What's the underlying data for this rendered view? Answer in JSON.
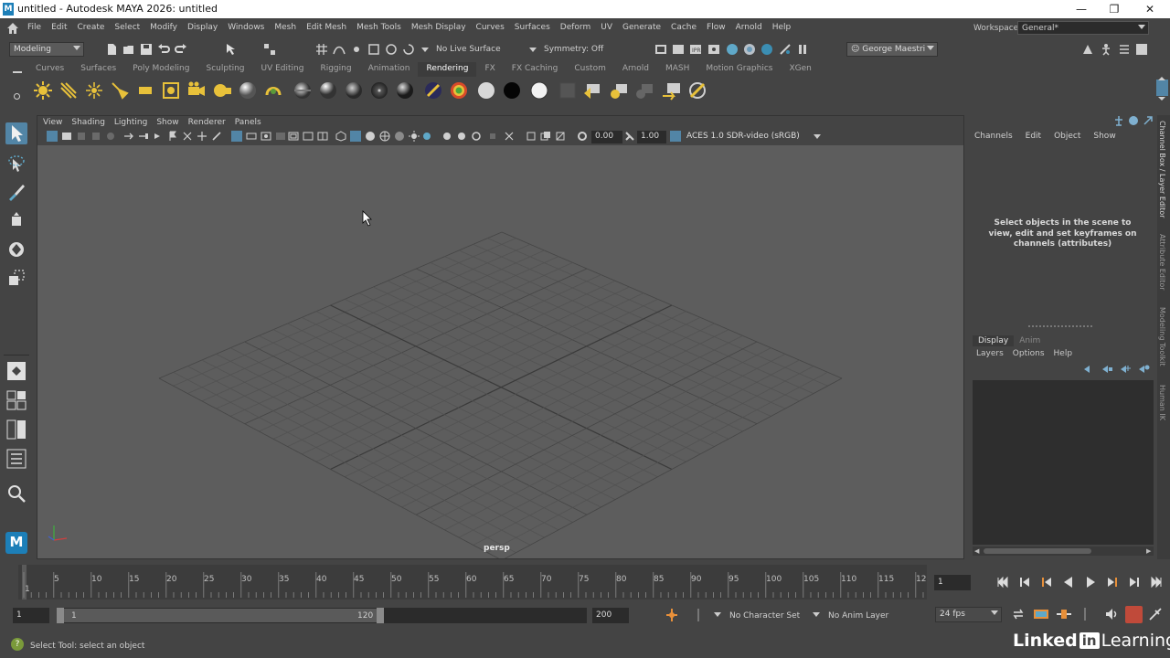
{
  "window": {
    "title": "untitled - Autodesk MAYA 2026: untitled",
    "app_icon_letter": "M"
  },
  "menubar": {
    "items": [
      "File",
      "Edit",
      "Create",
      "Select",
      "Modify",
      "Display",
      "Windows",
      "Mesh",
      "Edit Mesh",
      "Mesh Tools",
      "Mesh Display",
      "Curves",
      "Surfaces",
      "Deform",
      "UV",
      "Generate",
      "Cache",
      "Flow",
      "Arnold",
      "Help"
    ],
    "workspace_label": "Workspace:",
    "workspace_value": "General*"
  },
  "statusline": {
    "mode": "Modeling",
    "live_surface": "No Live Surface",
    "symmetry": "Symmetry: Off",
    "user": "George Maestri"
  },
  "shelf": {
    "tabs": [
      "Curves",
      "Surfaces",
      "Poly Modeling",
      "Sculpting",
      "UV Editing",
      "Rigging",
      "Animation",
      "Rendering",
      "FX",
      "FX Caching",
      "Custom",
      "Arnold",
      "MASH",
      "Motion Graphics",
      "XGen"
    ],
    "active_tab": "Rendering"
  },
  "viewport": {
    "menu": [
      "View",
      "Shading",
      "Lighting",
      "Show",
      "Renderer",
      "Panels"
    ],
    "exposure": "0.00",
    "gamma": "1.00",
    "color_space": "ACES 1.0 SDR-video (sRGB)",
    "camera": "persp"
  },
  "channel_box": {
    "menu": [
      "Channels",
      "Edit",
      "Object",
      "Show"
    ],
    "hint": "Select objects in the scene to view, edit and set keyframes on channels (attributes)"
  },
  "layer_editor": {
    "tabs": [
      "Display",
      "Anim"
    ],
    "active_tab": "Display",
    "menu": [
      "Layers",
      "Options",
      "Help"
    ]
  },
  "side_tabs": [
    "Channel Box / Layer Editor",
    "Attribute Editor",
    "Modeling Toolkit",
    "Human IK"
  ],
  "timeslider": {
    "ticks": [
      "1",
      "5",
      "10",
      "15",
      "20",
      "25",
      "30",
      "35",
      "40",
      "45",
      "50",
      "55",
      "60",
      "65",
      "70",
      "75",
      "80",
      "85",
      "90",
      "95",
      "100",
      "105",
      "110",
      "115",
      "12"
    ],
    "current_frame": "1"
  },
  "rangeslider": {
    "start": "1",
    "range_start": "1",
    "range_end": "120",
    "end": "200",
    "character_set": "No Character Set",
    "anim_layer": "No Anim Layer",
    "fps": "24 fps"
  },
  "helpline": {
    "text": "Select Tool: select an object"
  },
  "brand": {
    "part1": "Linked",
    "part2": "in",
    "part3": "Learning"
  }
}
